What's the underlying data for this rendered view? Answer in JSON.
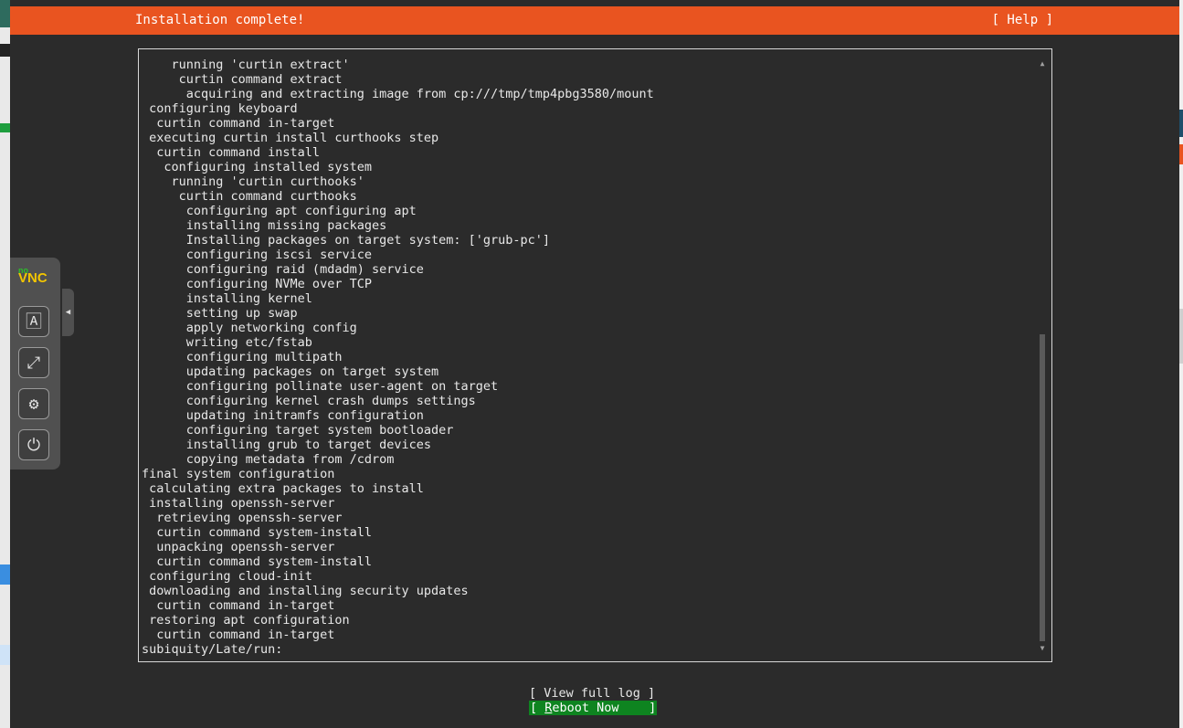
{
  "header": {
    "title": "Installation complete!",
    "help_label": "[ Help ]",
    "color": "#e95420"
  },
  "log": {
    "lines": [
      "    running 'curtin extract'",
      "     curtin command extract",
      "      acquiring and extracting image from cp:///tmp/tmp4pbg3580/mount",
      " configuring keyboard",
      "  curtin command in-target",
      " executing curtin install curthooks step",
      "  curtin command install",
      "   configuring installed system",
      "    running 'curtin curthooks'",
      "     curtin command curthooks",
      "      configuring apt configuring apt",
      "      installing missing packages",
      "      Installing packages on target system: ['grub-pc']",
      "      configuring iscsi service",
      "      configuring raid (mdadm) service",
      "      configuring NVMe over TCP",
      "      installing kernel",
      "      setting up swap",
      "      apply networking config",
      "      writing etc/fstab",
      "      configuring multipath",
      "      updating packages on target system",
      "      configuring pollinate user-agent on target",
      "      configuring kernel crash dumps settings",
      "      updating initramfs configuration",
      "      configuring target system bootloader",
      "      installing grub to target devices",
      "      copying metadata from /cdrom",
      "final system configuration",
      " calculating extra packages to install",
      " installing openssh-server",
      "  retrieving openssh-server",
      "  curtin command system-install",
      "  unpacking openssh-server",
      "  curtin command system-install",
      " configuring cloud-init",
      " downloading and installing security updates",
      "  curtin command in-target",
      " restoring apt configuration",
      "  curtin command in-target",
      "subiquity/Late/run:"
    ],
    "scroll_up_icon": "triangle-up-icon",
    "scroll_down_icon": "triangle-down-icon"
  },
  "buttons": {
    "view_log": "[ View full log ]",
    "reboot_prefix": "[ ",
    "reboot_underlined": "R",
    "reboot_rest": "eboot Now    ]",
    "reboot_color": "#0e8420"
  },
  "novnc": {
    "logo_no": "no",
    "logo_vnc": "VNC",
    "buttons": [
      {
        "icon": "keyboard-icon",
        "glyph": "🄰"
      },
      {
        "icon": "fullscreen-icon",
        "glyph": "⤢"
      },
      {
        "icon": "settings-gear-icon",
        "glyph": "⚙"
      },
      {
        "icon": "power-icon",
        "glyph": "⏻"
      }
    ],
    "handle_glyph": "◀"
  }
}
